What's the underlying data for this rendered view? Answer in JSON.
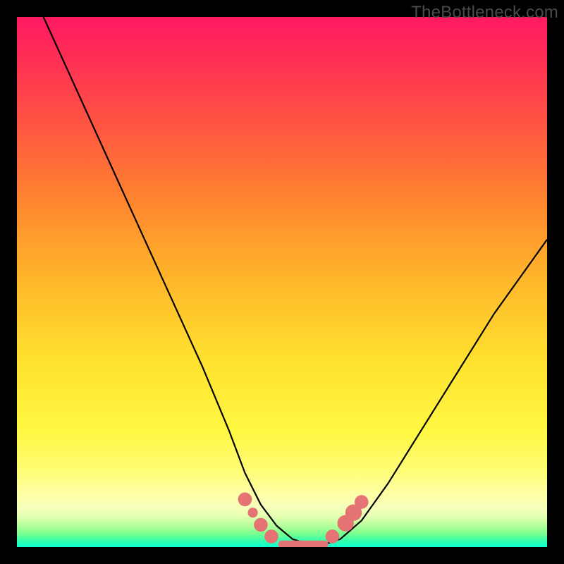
{
  "watermark": "TheBottleneck.com",
  "chart_data": {
    "type": "line",
    "title": "",
    "xlabel": "",
    "ylabel": "",
    "xlim": [
      0,
      100
    ],
    "ylim": [
      0,
      100
    ],
    "series": [
      {
        "name": "curve",
        "x": [
          5,
          10,
          15,
          20,
          25,
          30,
          35,
          40,
          43,
          46,
          49,
          52,
          55,
          58,
          61,
          65,
          70,
          75,
          80,
          85,
          90,
          95,
          100
        ],
        "y": [
          100,
          89,
          78,
          67,
          56,
          45,
          34,
          22,
          14,
          8,
          4,
          1.5,
          0.5,
          0.5,
          1.5,
          5,
          12,
          20,
          28,
          36,
          44,
          51,
          58
        ]
      }
    ],
    "markers": [
      {
        "x": 43.0,
        "y": 9.0,
        "r": 1.3
      },
      {
        "x": 44.5,
        "y": 6.5,
        "r": 0.95
      },
      {
        "x": 46.0,
        "y": 4.2,
        "r": 1.3
      },
      {
        "x": 48.0,
        "y": 2.0,
        "r": 1.3
      },
      {
        "x": 59.5,
        "y": 2.0,
        "r": 1.3
      },
      {
        "x": 62.0,
        "y": 4.5,
        "r": 1.55
      },
      {
        "x": 63.5,
        "y": 6.5,
        "r": 1.55
      },
      {
        "x": 65.0,
        "y": 8.5,
        "r": 1.3
      }
    ],
    "flat_segment": {
      "x0": 50,
      "x1": 58,
      "y": 0.5
    }
  }
}
